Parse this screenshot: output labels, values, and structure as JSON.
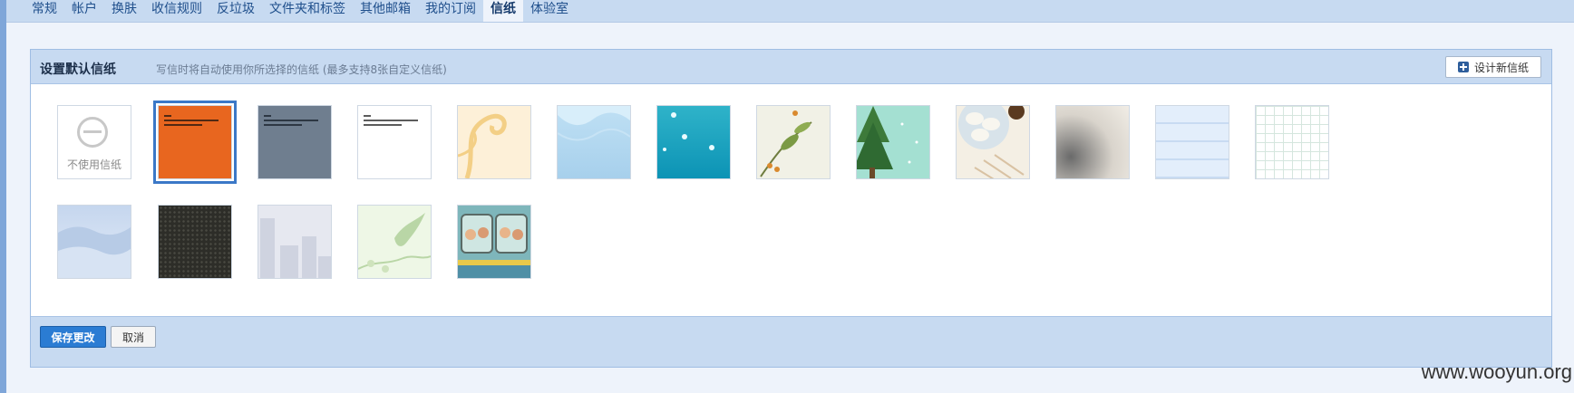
{
  "nav": {
    "tabs": [
      {
        "label": "常规"
      },
      {
        "label": "帐户"
      },
      {
        "label": "换肤"
      },
      {
        "label": "收信规则"
      },
      {
        "label": "反垃圾"
      },
      {
        "label": "文件夹和标签"
      },
      {
        "label": "其他邮箱"
      },
      {
        "label": "我的订阅"
      },
      {
        "label": "信纸",
        "active": true
      },
      {
        "label": "体验室"
      }
    ]
  },
  "panel": {
    "title": "设置默认信纸",
    "hint": "写信时将自动使用你所选择的信纸 (最多支持8张自定义信纸)",
    "design_button": "设计新信纸"
  },
  "stationery": {
    "none_label": "不使用信纸",
    "selected_index": 1,
    "colors": {
      "orange": "#e8661f",
      "slate": "#6f7e8f",
      "selection": "#3b78c7"
    }
  },
  "footer": {
    "save_label": "保存更改",
    "cancel_label": "取消"
  },
  "watermark": "www.wooyun.org"
}
